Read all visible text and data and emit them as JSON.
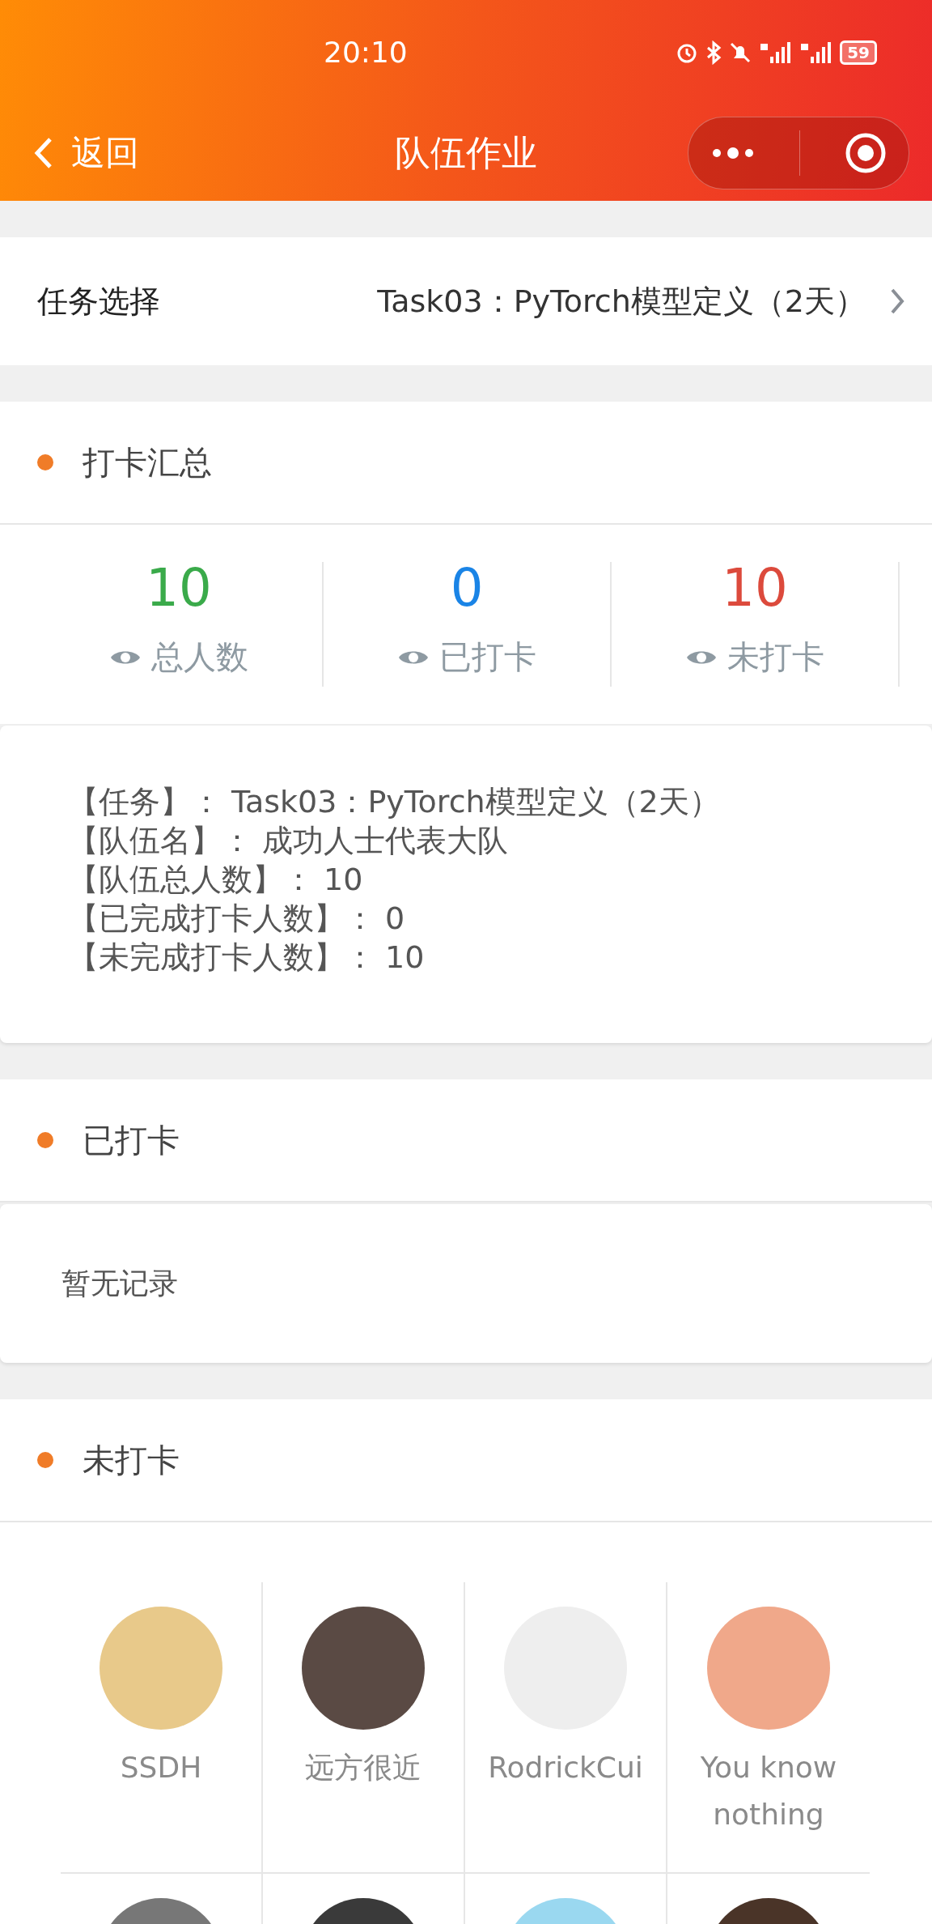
{
  "status_bar": {
    "time": "20:10",
    "battery": "59"
  },
  "nav_bar": {
    "back": "返回",
    "title": "队伍作业"
  },
  "task_select": {
    "label": "任务选择",
    "value": "Task03：PyTorch模型定义（2天）"
  },
  "summary": {
    "title": "打卡汇总",
    "stats": [
      {
        "value": "10",
        "label": "总人数",
        "color": "#3aaa4a"
      },
      {
        "value": "0",
        "label": "已打卡",
        "color": "#1a84e6"
      },
      {
        "value": "10",
        "label": "未打卡",
        "color": "#dc4a3c"
      }
    ],
    "info_lines": [
      "【任务】： Task03：PyTorch模型定义（2天）",
      "【队伍名】： 成功人士代表大队",
      "【队伍总人数】： 10",
      "【已完成打卡人数】： 0",
      "【未完成打卡人数】： 10"
    ]
  },
  "checked_in": {
    "title": "已打卡",
    "empty_text": "暂无记录"
  },
  "not_checked_in": {
    "title": "未打卡",
    "members": [
      {
        "name": "SSDH"
      },
      {
        "name": "远方很近"
      },
      {
        "name": "RodrickCui"
      },
      {
        "name": "You know nothing"
      }
    ],
    "more_avatars_below": true
  }
}
